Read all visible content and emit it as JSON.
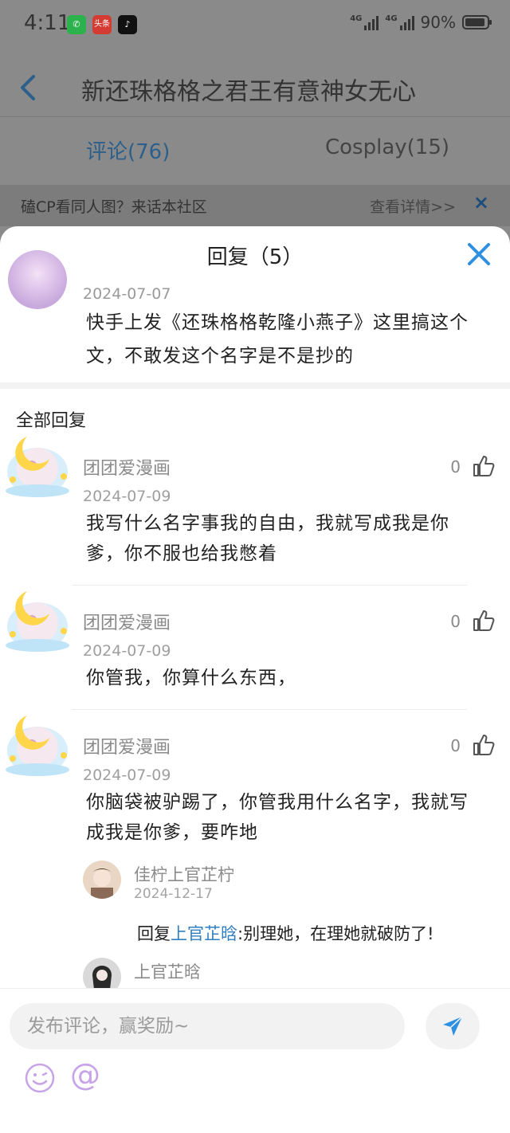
{
  "status_bar": {
    "time": "4:11",
    "apps": [
      {
        "name": "wechat-icon",
        "glyph": "✆",
        "color": "#2bb24c"
      },
      {
        "name": "toutiao-icon",
        "glyph": "头条",
        "color": "#d43c33"
      },
      {
        "name": "douyin-icon",
        "glyph": "♪",
        "color": "#111111"
      }
    ],
    "network_1": "4G",
    "network_2": "4G",
    "battery": "90%"
  },
  "header": {
    "title": "新还珠格格之君王有意神女无心",
    "tabs": [
      {
        "label": "评论(76)",
        "active": true
      },
      {
        "label": "Cosplay(15)",
        "active": false
      }
    ]
  },
  "banner": {
    "text": "磕CP看同人图？来话本社区",
    "link": "查看详情>>",
    "close": "×"
  },
  "sheet": {
    "title": "回复（5）",
    "original": {
      "date": "2024-07-07",
      "text": "快手上发《还珠格格乾隆小燕子》这里搞这个文，不敢发这个名字是不是抄的"
    },
    "all_label": "全部回复",
    "replies": [
      {
        "name": "团团爱漫画",
        "date": "2024-07-09",
        "text": "我写什么名字事我的自由，我就写成我是你爹，你不服也给我憋着",
        "likes": "0"
      },
      {
        "name": "团团爱漫画",
        "date": "2024-07-09",
        "text": "你管我，你算什么东西，",
        "likes": "0"
      },
      {
        "name": "团团爱漫画",
        "date": "2024-07-09",
        "text": "你脑袋被驴踢了，你管我用什么名字，我就写成我是你爹，要咋地",
        "likes": "0"
      }
    ],
    "sub_replies": [
      {
        "name": "佳柠上官芷柠",
        "date": "2024-12-17",
        "prefix": "回复",
        "mention": "上官芷晗",
        "text": ":别理她，在理她就破防了!"
      },
      {
        "name": "上官芷晗"
      }
    ]
  },
  "input_bar": {
    "placeholder": "发布评论，赢奖励~",
    "at_symbol": "@"
  },
  "colors": {
    "accent": "#2f7fc1",
    "emoji": "#c7a4e8"
  }
}
